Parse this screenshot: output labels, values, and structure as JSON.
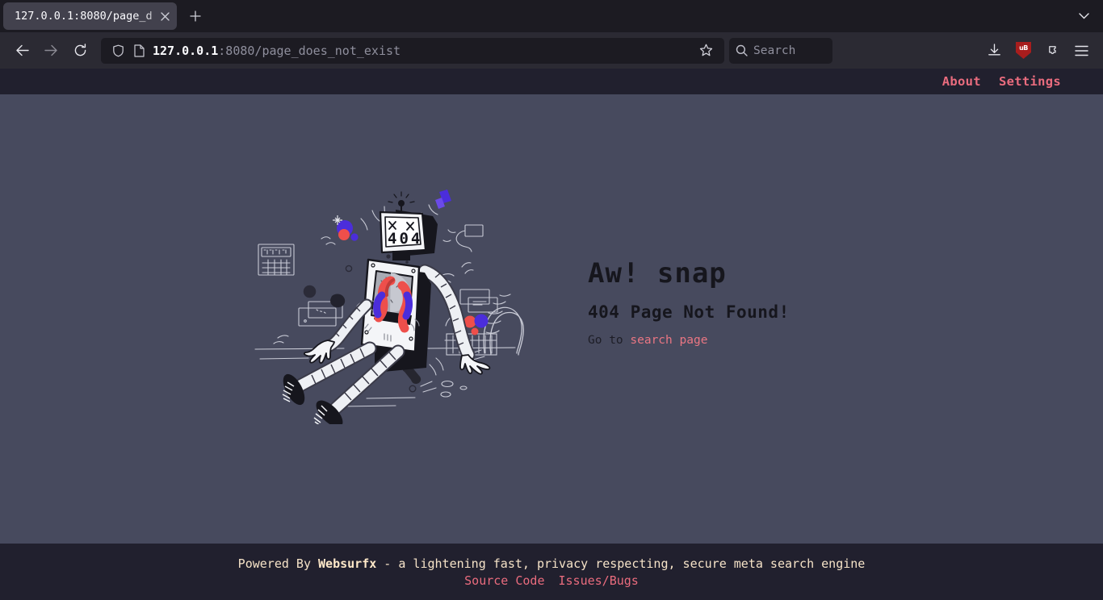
{
  "browser": {
    "tab": {
      "title": "127.0.0.1:8080/page_d",
      "close_icon": "close-icon"
    },
    "new_tab_label": "+",
    "tab_list_icon": "chevron-down-icon",
    "back_icon": "arrow-left-icon",
    "forward_icon": "arrow-right-icon",
    "reload_icon": "reload-icon",
    "shield_icon": "shield-icon",
    "page_icon": "document-icon",
    "url_host": "127.0.0.1",
    "url_rest": ":8080/page_does_not_exist",
    "bookmark_icon": "star-icon",
    "search": {
      "placeholder": "Search",
      "icon": "search-icon"
    },
    "downloads_icon": "download-icon",
    "ublock": {
      "icon": "ublock-shield-icon",
      "label": "uB"
    },
    "extensions_icon": "extension-puzzle-icon",
    "menu_icon": "hamburger-menu-icon"
  },
  "site": {
    "header": {
      "about_label": "About",
      "settings_label": "Settings"
    },
    "error": {
      "title": "Aw! snap",
      "subtitle": "404 Page Not Found!",
      "goto_prefix": "Go to ",
      "goto_link": "search page",
      "illustration_name": "broken-robot-404-illustration",
      "screen_text": "404"
    },
    "footer": {
      "powered_by_prefix": "Powered By ",
      "brand": "Websurfx",
      "tagline": " - a lightening fast, privacy respecting, secure meta search engine",
      "source_code_label": "Source Code",
      "issues_label": "Issues/Bugs"
    }
  },
  "colors": {
    "page_bg": "#474a5e",
    "bar_bg": "#21202e",
    "accent_pink": "#ea6c7e",
    "footer_text": "#f6e3c8",
    "heading": "#16161d",
    "chrome_bg": "#1c1b22",
    "navbar_bg": "#2b2a33"
  }
}
